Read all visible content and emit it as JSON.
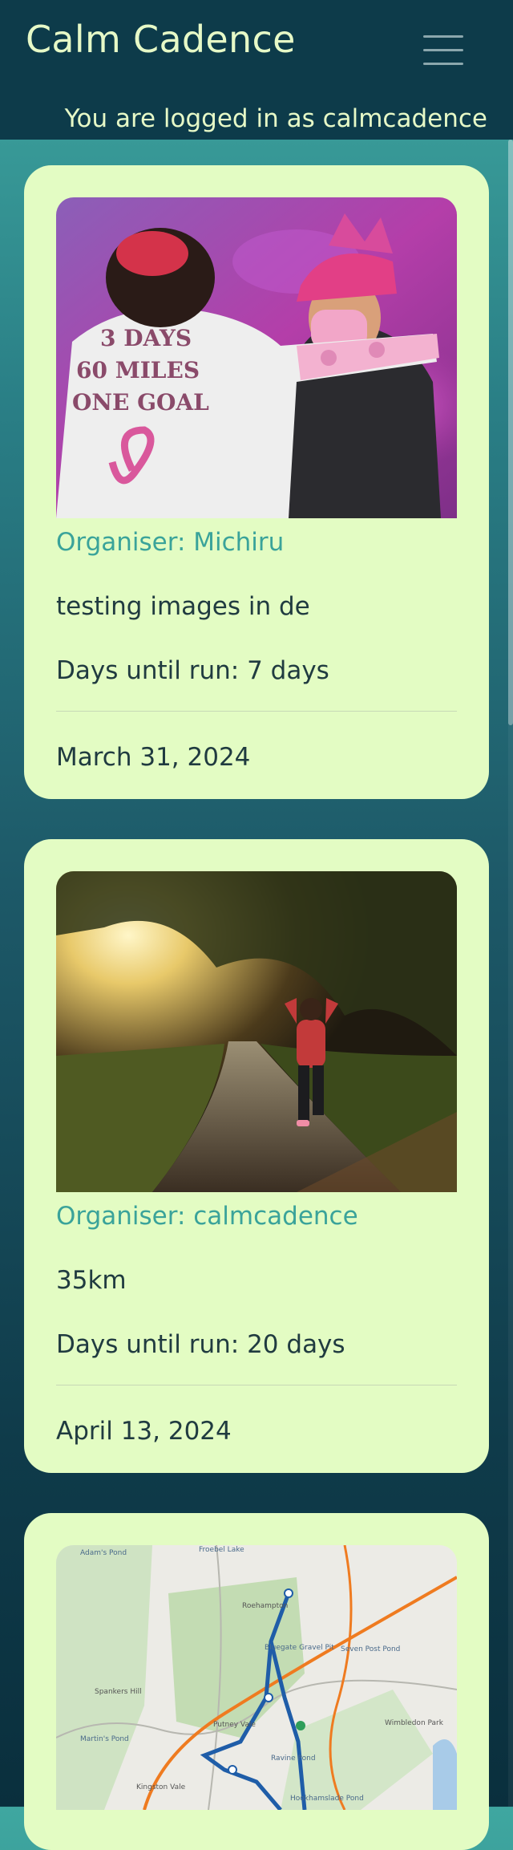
{
  "header": {
    "brand": "Calm Cadence",
    "login_status": "You are logged in as calmcadence",
    "menu_icon": "hamburger-menu-icon"
  },
  "runs": [
    {
      "image_alt": "Two people hugging, one wearing a shirt reading 3 DAYS 60 MILES ONE GOAL with a pink ribbon",
      "shirt_text": [
        "3 DAYS",
        "60 MILES",
        "ONE GOAL"
      ],
      "organiser": "Organiser: Michiru",
      "description": "testing images in de",
      "days_until": "Days until run: 7 days",
      "date": "March 31, 2024"
    },
    {
      "image_alt": "Runner in a red top on a sunlit tree-lined path",
      "organiser": "Organiser: calmcadence",
      "description": "35km",
      "days_until": "Days until run: 20 days",
      "date": "April 13, 2024"
    },
    {
      "image_alt": "Map of a running route across a common",
      "map_labels": [
        "Adam's Pond",
        "Froebel Lake",
        "Roehampton",
        "Putney Vale",
        "Spankers Hill",
        "Martin's Pond",
        "Kingston Vale",
        "Wimbledon Park",
        "Seven Post Pond",
        "Bluegate Gravel Pit",
        "Ravine Pond",
        "Hookhamslade Pond"
      ]
    }
  ],
  "colors": {
    "header_bg": "#0d3b4a",
    "card_bg": "#e3fcc3",
    "accent": "#3aa39a",
    "brand_text": "#e6f9c7",
    "body_text": "#203b40"
  }
}
